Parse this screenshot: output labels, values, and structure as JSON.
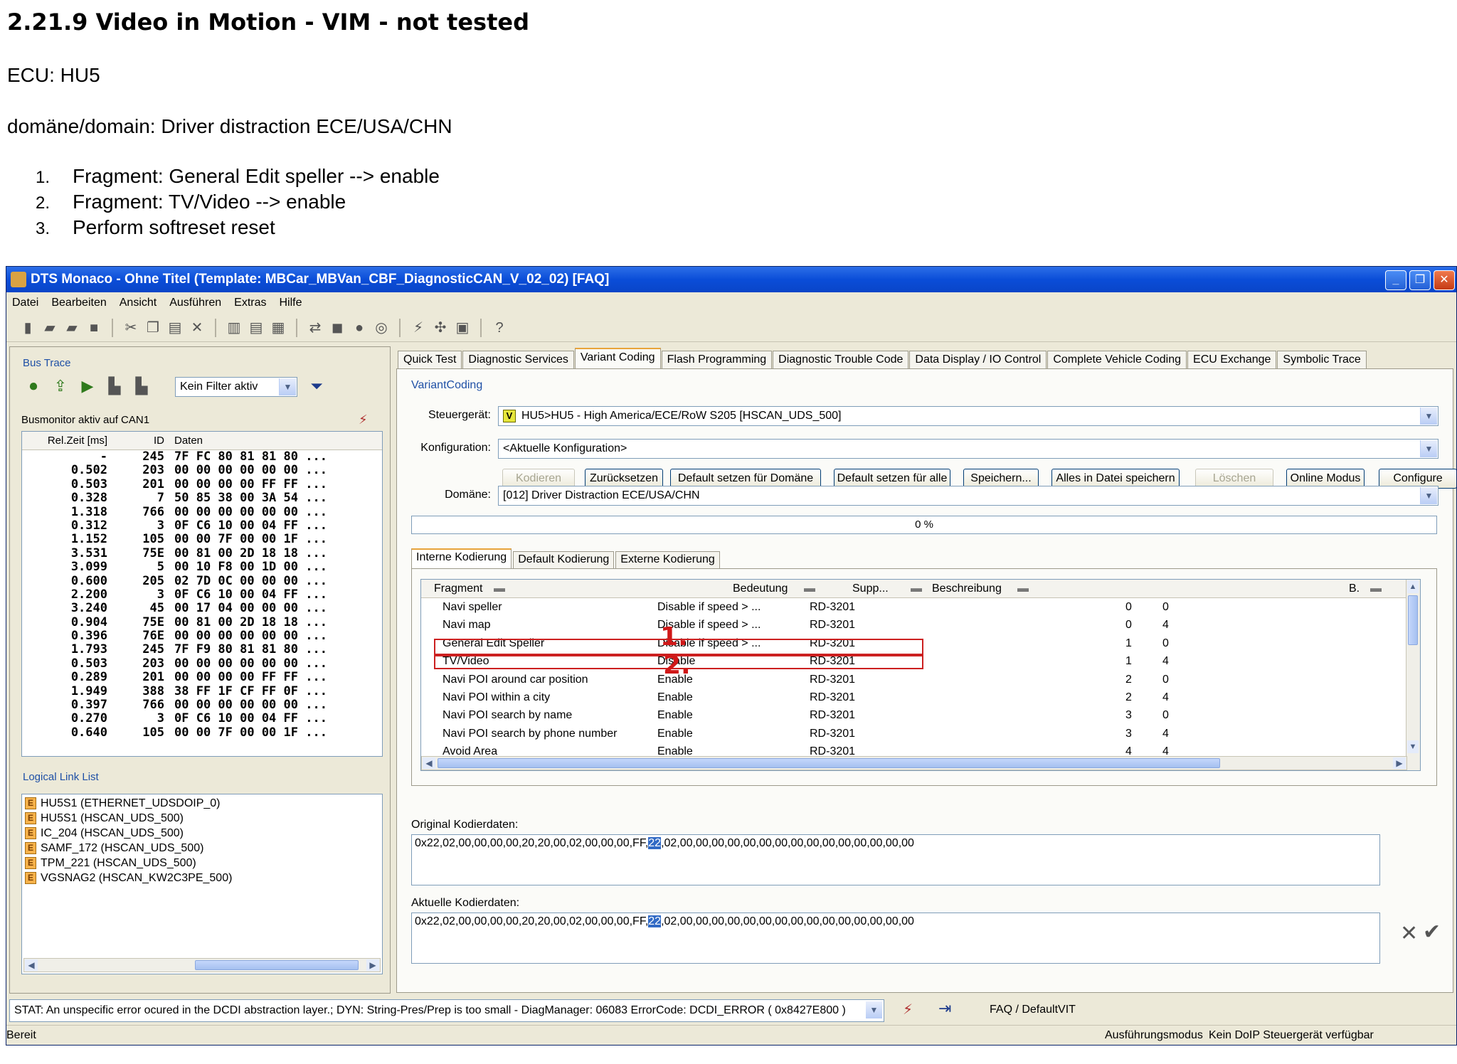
{
  "doc": {
    "title": "2.21.9 Video in Motion - VIM - not tested",
    "ecu": "ECU: HU5",
    "domain": "domäne/domain: Driver distraction ECE/USA/CHN",
    "steps": [
      {
        "num": "1.",
        "text": "Fragment: General Edit speller --> enable"
      },
      {
        "num": "2.",
        "text": "Fragment: TV/Video --> enable"
      },
      {
        "num": "3.",
        "text": "Perform softreset reset"
      }
    ]
  },
  "window": {
    "title": "DTS Monaco  - Ohne Titel (Template: MBCar_MBVan_CBF_DiagnosticCAN_V_02_02) [FAQ]",
    "minimize": "_",
    "maximize": "❐",
    "close": "✕"
  },
  "menu": [
    "Datei",
    "Bearbeiten",
    "Ansicht",
    "Ausführen",
    "Extras",
    "Hilfe"
  ],
  "bus_trace": {
    "title": "Bus Trace",
    "filter": "Kein Filter aktiv",
    "status": "Busmonitor aktiv auf CAN1",
    "headers": {
      "relzeit": "Rel.Zeit [ms]",
      "id": "ID",
      "daten": "Daten"
    },
    "rows": [
      [
        "-",
        "245",
        "7F FC 80 81 81 80 ..."
      ],
      [
        "0.502",
        "203",
        "00 00 00 00 00 00 ..."
      ],
      [
        "0.503",
        "201",
        "00 00 00 00 FF FF ..."
      ],
      [
        "0.328",
        "7",
        "50 85 38 00 3A 54 ..."
      ],
      [
        "1.318",
        "766",
        "00 00 00 00 00 00 ..."
      ],
      [
        "0.312",
        "3",
        "0F C6 10 00 04 FF ..."
      ],
      [
        "1.152",
        "105",
        "00 00 7F 00 00 1F ..."
      ],
      [
        "3.531",
        "75E",
        "00 81 00 2D 18 18 ..."
      ],
      [
        "3.099",
        "5",
        "00 10 F8 00 1D 00 ..."
      ],
      [
        "0.600",
        "205",
        "02 7D 0C 00 00 00 ..."
      ],
      [
        "2.200",
        "3",
        "0F C6 10 00 04 FF ..."
      ],
      [
        "3.240",
        "45",
        "00 17 04 00 00 00 ..."
      ],
      [
        "0.904",
        "75E",
        "00 81 00 2D 18 18 ..."
      ],
      [
        "0.396",
        "76E",
        "00 00 00 00 00 00 ..."
      ],
      [
        "1.793",
        "245",
        "7F F9 80 81 81 80 ..."
      ],
      [
        "0.503",
        "203",
        "00 00 00 00 00 00 ..."
      ],
      [
        "0.289",
        "201",
        "00 00 00 00 FF FF ..."
      ],
      [
        "1.949",
        "388",
        "38 FF 1F CF FF 0F ..."
      ],
      [
        "0.397",
        "766",
        "00 00 00 00 00 00 ..."
      ],
      [
        "0.270",
        "3",
        "0F C6 10 00 04 FF ..."
      ],
      [
        "0.640",
        "105",
        "00 00 7F 00 00 1F ..."
      ]
    ]
  },
  "logical_links": {
    "title": "Logical Link List",
    "icon_letter": "E",
    "items": [
      "HU5S1 (ETHERNET_UDSDOIP_0)",
      "HU5S1 (HSCAN_UDS_500)",
      "IC_204 (HSCAN_UDS_500)",
      "SAMF_172 (HSCAN_UDS_500)",
      "TPM_221 (HSCAN_UDS_500)",
      "VGSNAG2 (HSCAN_KW2C3PE_500)"
    ]
  },
  "tabs": [
    "Quick Test",
    "Diagnostic Services",
    "Variant Coding",
    "Flash Programming",
    "Diagnostic Trouble Code",
    "Data Display / IO Control",
    "Complete Vehicle Coding",
    "ECU Exchange",
    "Symbolic Trace"
  ],
  "active_tab": "Variant Coding",
  "variant_coding": {
    "title": "VariantCoding",
    "steuergeraet_label": "Steuergerät:",
    "steuergeraet_badge": "V",
    "steuergeraet_value": "HU5>HU5 - High America/ECE/RoW S205 [HSCAN_UDS_500]",
    "konfiguration_label": "Konfiguration:",
    "konfiguration_value": "<Aktuelle Konfiguration>",
    "buttons": {
      "kodieren": "Kodieren",
      "zuruecksetzen": "Zurücksetzen",
      "default_domaene": "Default setzen für Domäne",
      "default_alle": "Default setzen für alle",
      "speichern": "Speichern...",
      "alles_speichern": "Alles in Datei speichern",
      "loeschen": "Löschen",
      "online_modus": "Online Modus",
      "configure": "Configure"
    },
    "domaene_label": "Domäne:",
    "domaene_value": "[012] Driver Distraction ECE/USA/CHN",
    "progress_text": "0 %",
    "progress": 0,
    "subtabs": [
      "Interne Kodierung",
      "Default Kodierung",
      "Externe Kodierung"
    ],
    "grid_headers": {
      "fragment": "Fragment",
      "bedeutung": "Bedeutung",
      "supp": "Supp...",
      "beschreibung": "Beschreibung",
      "b": "B."
    },
    "grid_rows": [
      [
        "Navi speller",
        "Disable if speed > ...",
        "",
        "RD-3201",
        "0",
        "0"
      ],
      [
        "Navi map",
        "Disable if speed > ...",
        "",
        "RD-3201",
        "0",
        "4"
      ],
      [
        "General Edit Speller",
        "Disable if speed > ...",
        "",
        "RD-3201",
        "1",
        "0"
      ],
      [
        "TV/Video",
        "Disable",
        "",
        "RD-3201",
        "1",
        "4"
      ],
      [
        "Navi POI around car position",
        "Enable",
        "",
        "RD-3201",
        "2",
        "0"
      ],
      [
        "Navi POI within a city",
        "Enable",
        "",
        "RD-3201",
        "2",
        "4"
      ],
      [
        "Navi POI search by name",
        "Enable",
        "",
        "RD-3201",
        "3",
        "0"
      ],
      [
        "Navi POI search by phone number",
        "Enable",
        "",
        "RD-3201",
        "3",
        "4"
      ],
      [
        "Avoid Area",
        "Enable",
        "",
        "RD-3201",
        "4",
        "4"
      ]
    ],
    "annotations": [
      "1.",
      "2."
    ],
    "original_label": "Original Kodierdaten:",
    "original_pre": "0x22,02,00,00,00,00,20,20,00,02,00,00,00,FF,",
    "original_sel": "22",
    "original_post": ",02,00,00,00,00,00,00,00,00,00,00,00,00,00,00,00",
    "aktuelle_label": "Aktuelle Kodierdaten:",
    "aktuelle_pre": "0x22,02,00,00,00,00,20,20,00,02,00,00,00,FF,",
    "aktuelle_sel": "22",
    "aktuelle_post": ",02,00,00,00,00,00,00,00,00,00,00,00,00,00,00,00",
    "cancel_glyph": "✕",
    "confirm_glyph": "✔"
  },
  "status_line": {
    "message": "STAT: An unspecific error ocured in the DCDI abstraction layer.; DYN: String-Pres/Prep is too small - DiagManager: 06083 ErrorCode: DCDI_ERROR  ( 0x8427E800 )",
    "profile": "FAQ / DefaultVIT"
  },
  "statusbar": {
    "left": "Bereit",
    "mode": "Ausführungsmodus",
    "doip": "Kein DoIP Steuergerät verfügbar"
  }
}
